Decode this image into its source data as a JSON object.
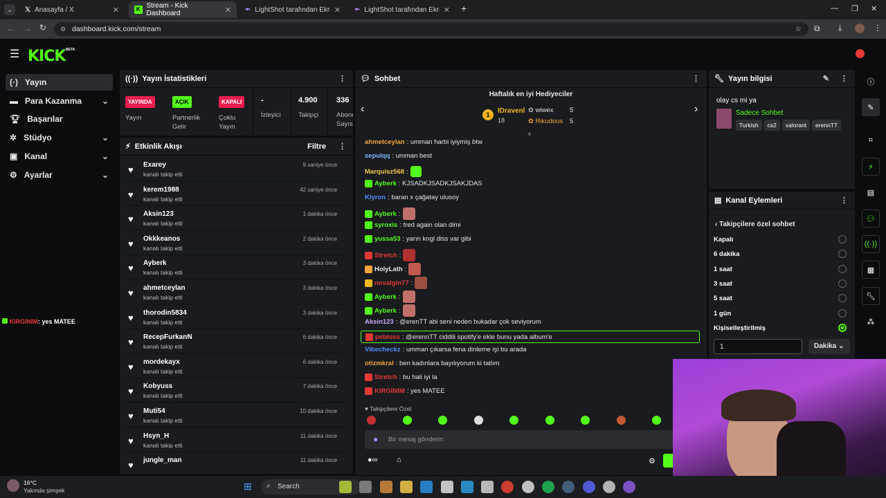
{
  "browser": {
    "tabs": [
      {
        "label": "Anasayfa / X",
        "active": false
      },
      {
        "label": "Stream - Kick Dashboard",
        "active": true
      },
      {
        "label": "LightShot tarafından Ekran Gör",
        "active": false
      },
      {
        "label": "LightShot tarafından Ekran Gör",
        "active": false
      }
    ],
    "url": "dashboard.kick.com/stream"
  },
  "app": {
    "logo": "KICK",
    "logo_sup": "BETA"
  },
  "sidebar": {
    "items": [
      {
        "label": "Yayın",
        "icon": "broadcast-icon"
      },
      {
        "label": "Para Kazanma",
        "icon": "dollar-icon"
      },
      {
        "label": "Başarılar",
        "icon": "trophy-icon"
      },
      {
        "label": "Stüdyo",
        "icon": "gear-icon"
      },
      {
        "label": "Kanal",
        "icon": "video-icon"
      },
      {
        "label": "Ayarlar",
        "icon": "settings-icon"
      }
    ],
    "overlay_msg": {
      "user": "KIRGINIM",
      "text": ": yes MATEE"
    }
  },
  "stats": {
    "title": "Yayın İstatistikleri",
    "cells": [
      {
        "value": "YAYINDA",
        "label": "Yayın",
        "color": "#e91e4f"
      },
      {
        "value": "AÇIK",
        "label": "Partnerlik Gelir Programı",
        "color": "#53fc18"
      },
      {
        "value": "KAPALI",
        "label": "Çoklu Yayın",
        "color": "#e91e4f"
      },
      {
        "value": "-",
        "label": "İzleyici"
      },
      {
        "value": "4.900",
        "label": "Takipçi"
      },
      {
        "value": "336",
        "label": "Abone Sayısı"
      }
    ]
  },
  "activity": {
    "title": "Etkinlik Akışı",
    "filter": "Filtre",
    "items": [
      {
        "name": "Exarey",
        "sub": "kanalı takip etti",
        "time": "9 saniye önce"
      },
      {
        "name": "kerem1988",
        "sub": "kanalı takip etti",
        "time": "42 saniye önce"
      },
      {
        "name": "Aksin123",
        "sub": "kanalı takip etti",
        "time": "1 dakika önce"
      },
      {
        "name": "Okkkeanos",
        "sub": "kanalı takip etti",
        "time": "2 dakika önce"
      },
      {
        "name": "Ayberk",
        "sub": "kanalı takip etti",
        "time": "3 dakika önce"
      },
      {
        "name": "ahmetceylan",
        "sub": "kanalı takip etti",
        "time": "3 dakika önce"
      },
      {
        "name": "thorodin5834",
        "sub": "kanalı takip etti",
        "time": "3 dakika önce"
      },
      {
        "name": "RecepFurkanN",
        "sub": "kanalı takip etti",
        "time": "6 dakika önce"
      },
      {
        "name": "mordekayx",
        "sub": "kanalı takip etti",
        "time": "6 dakika önce"
      },
      {
        "name": "Kobyuss",
        "sub": "kanalı takip etti",
        "time": "7 dakika önce"
      },
      {
        "name": "Muti54",
        "sub": "kanalı takip etti",
        "time": "10 dakika önce"
      },
      {
        "name": "Hsyn_H",
        "sub": "kanalı takip etti",
        "time": "11 dakika önce"
      },
      {
        "name": "jungle_man",
        "sub": "",
        "time": "11 dakika önce"
      }
    ]
  },
  "chat": {
    "title": "Sohbet",
    "gifters_title": "Haftalık en iyi Hediyeciler",
    "gifters": [
      {
        "rank": "1",
        "name": "IDravenl",
        "count": "18"
      },
      {
        "name": "wiwex",
        "count": "5"
      },
      {
        "name": "Rikudous",
        "count": "5"
      }
    ],
    "messages": [
      {
        "user": "ahmetceylan",
        "text": ": umman harbi iyiymiş btw",
        "color": "#f2a33c"
      },
      {
        "user": "sepulqq",
        "text": ": umman best",
        "color": "#7fb6ff"
      },
      {
        "user": "Marquisz568",
        "text": ":",
        "color": "#f2c94c"
      },
      {
        "user": "Ayberk",
        "text": ": KJSADKJSADKJSAKJDAS",
        "color": "#53fc18"
      },
      {
        "user": "Klyron",
        "text": ": baran x çağatay ulusoy",
        "color": "#4f8cff"
      },
      {
        "user": "Ayberk",
        "text": ":",
        "color": "#53fc18"
      },
      {
        "user": "syroxis",
        "text": ": fred again olan dimi",
        "color": "#53fc18"
      },
      {
        "user": "yussa53",
        "text": ": yarın kngl diss var gibi",
        "color": "#53fc18"
      },
      {
        "user": "Stretch",
        "text": ":",
        "color": "#e53935"
      },
      {
        "user": "HolyLath",
        "text": ":",
        "color": "#e8e8e8"
      },
      {
        "user": "novalgin77",
        "text": ":",
        "color": "#e53935"
      },
      {
        "user": "Ayberk",
        "text": ":",
        "color": "#53fc18"
      },
      {
        "user": "Ayberk",
        "text": ":",
        "color": "#53fc18"
      },
      {
        "user": "Aksin123",
        "text": ": @erenTT abi seni neden bukadar çok seviyorum",
        "color": "#c9a8ff"
      },
      {
        "user": "pebloss",
        "text": ": @erennTT ciddili spotify'e ekle bunu yada album'e",
        "color": "#e53935"
      },
      {
        "user": "Vibecheckz",
        "text": ": umman çıkarsa fena dinleme işi bu arada",
        "color": "#4f8cff"
      },
      {
        "user": "otizmkral",
        "text": ": ben kadınlara bayılıyorum ki tatlım",
        "color": "#f2a33c"
      },
      {
        "user": "Stretch",
        "text": ": bu hali iyi la",
        "color": "#e53935"
      },
      {
        "user": "KIRGINIM",
        "text": ": yes MATEE",
        "color": "#e53935"
      }
    ],
    "followers_only": "Takipçilere Özel",
    "input_placeholder": "Bir mesaj gönderin"
  },
  "streaminfo": {
    "title": "Yayın bilgisi",
    "stream_title": "olay cs mi ya",
    "category": "Sadece Sohbet",
    "tags": [
      "Turkish",
      "cs2",
      "valorant",
      "erennTT"
    ]
  },
  "channel_actions": {
    "title": "Kanal Eylemleri",
    "subtitle": "Takipçilere özel sohbet",
    "options": [
      {
        "label": "Kapalı",
        "selected": false
      },
      {
        "label": "6 dakika",
        "selected": false
      },
      {
        "label": "1 saat",
        "selected": false
      },
      {
        "label": "3 saat",
        "selected": false
      },
      {
        "label": "5 saat",
        "selected": false
      },
      {
        "label": "1 gün",
        "selected": false
      },
      {
        "label": "Kişiselleştirilmiş",
        "selected": true
      }
    ],
    "custom_value": "1",
    "unit": "Dakika"
  },
  "taskbar": {
    "weather_temp": "16°C",
    "weather_text": "Yakında şimşek",
    "search": "Search"
  }
}
